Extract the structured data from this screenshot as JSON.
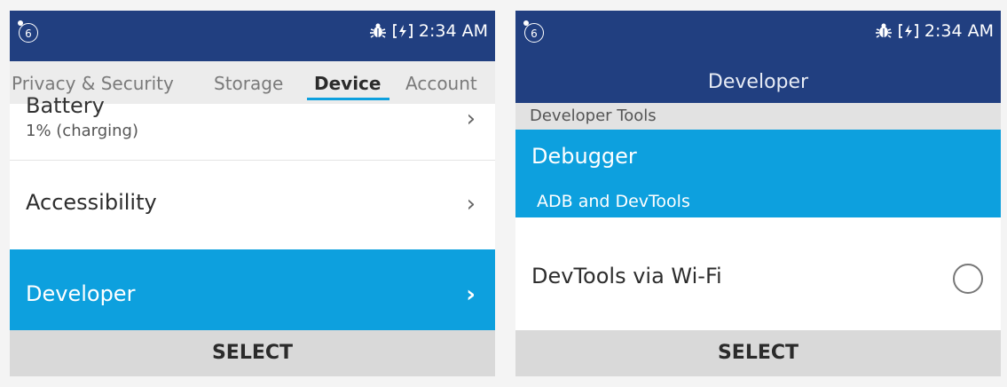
{
  "status": {
    "notification_count": "6",
    "time": "2:34 AM",
    "icons": [
      "bug-icon",
      "battery-charging-icon"
    ]
  },
  "left": {
    "tabs": [
      {
        "label": "Privacy & Security"
      },
      {
        "label": "Storage"
      },
      {
        "label": "Device",
        "active": true
      },
      {
        "label": "Account"
      }
    ],
    "battery": {
      "title": "Battery",
      "subtitle": "1% (charging)"
    },
    "accessibility": {
      "title": "Accessibility"
    },
    "developer": {
      "title": "Developer"
    },
    "chevron": "›",
    "softkey": "SELECT"
  },
  "right": {
    "header_title": "Developer",
    "section_label": "Developer Tools",
    "debugger": {
      "title": "Debugger",
      "subtitle": "ADB and DevTools"
    },
    "devtools_wifi": {
      "title": "DevTools via Wi-Fi",
      "checked": false
    },
    "softkey": "SELECT"
  },
  "colors": {
    "status_bar": "#213f80",
    "accent": "#0da0de",
    "softkey_bg": "#d9d9d9",
    "tab_bg": "#ececec"
  }
}
